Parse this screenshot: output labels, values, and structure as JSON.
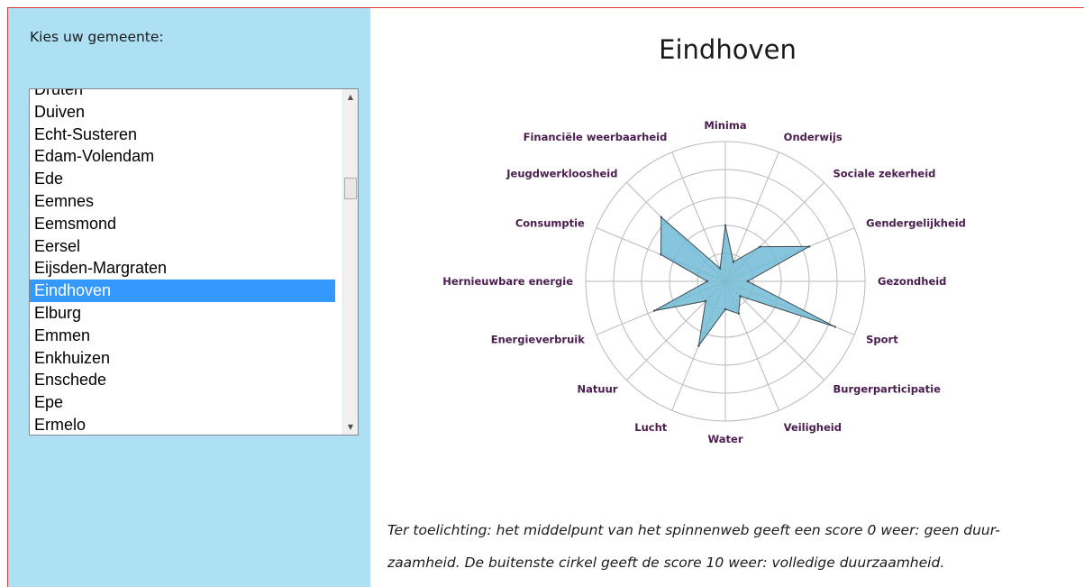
{
  "sidebar": {
    "label": "Kies uw gemeente:",
    "municipalities": [
      "Druten",
      "Duiven",
      "Echt-Susteren",
      "Edam-Volendam",
      "Ede",
      "Eemnes",
      "Eemsmond",
      "Eersel",
      "Eijsden-Margraten",
      "Eindhoven",
      "Elburg",
      "Emmen",
      "Enkhuizen",
      "Enschede",
      "Epe",
      "Ermelo"
    ],
    "selected": "Eindhoven"
  },
  "main": {
    "title": "Eindhoven",
    "caption_line1": "Ter toelichting: het middelpunt van het spinnenweb geeft een score 0 weer: geen duur-",
    "caption_line2": "zaamheid. De buitenste cirkel geeft de score 10 weer: volledige duurzaamheid."
  },
  "colors": {
    "sidebar_bg": "#ade0f2",
    "selection": "#3399ff",
    "radar_fill": "#71bbd5",
    "radar_stroke": "#3d4a52",
    "axis_label": "#4a1d4f",
    "frame_border": "#e2393b"
  },
  "chart_data": {
    "type": "radar",
    "title": "Eindhoven",
    "rmax": 10,
    "rings": 5,
    "axes": [
      "Minima",
      "Onderwijs",
      "Sociale zekerheid",
      "Gendergelijkheid",
      "Gezondheid",
      "Sport",
      "Burgerparticipatie",
      "Veiligheid",
      "Water",
      "Lucht",
      "Natuur",
      "Energieverbruik",
      "Hernieuwbare energie",
      "Consumptie",
      "Jeugdwerkloosheid",
      "Financiële weerbaarheid"
    ],
    "series": [
      {
        "values": [
          4,
          1.5,
          3.5,
          6.5,
          1.6,
          8.5,
          1.5,
          2.5,
          2,
          5,
          2,
          5.5,
          1.3,
          5,
          6.5,
          1
        ]
      }
    ]
  }
}
